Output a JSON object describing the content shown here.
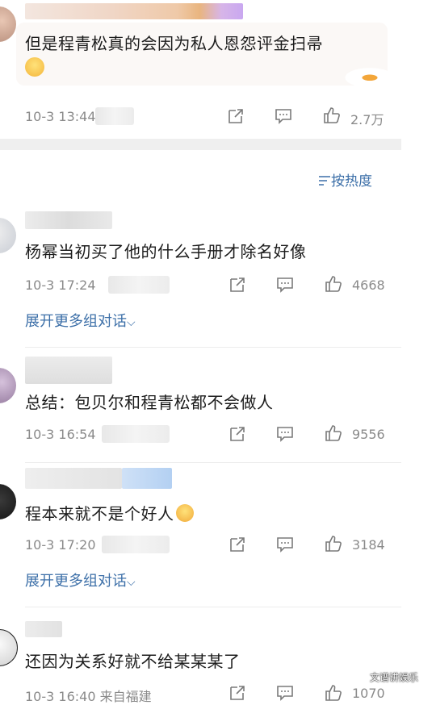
{
  "sort": {
    "label": "按热度",
    "icon": "sort-lines-icon"
  },
  "expand_label": "展开更多组对话",
  "watermark": "文谱讲娱乐",
  "colors": {
    "link": "#3c6fa8",
    "meta": "#8a8a8a",
    "icon": "#7a7a7a"
  },
  "top_comment": {
    "text": "但是程青松真的会因为私人恩怨评金扫帚",
    "time": "10-3 13:44",
    "likes": "2.7万"
  },
  "comments": [
    {
      "text": "杨幂当初买了他的什么手册才除名好像",
      "time": "10-3 17:24",
      "likes": "4668"
    },
    {
      "text": "总结：包贝尔和程青松都不会做人",
      "time": "10-3 16:54",
      "likes": "9556"
    },
    {
      "text": "程本来就不是个好人",
      "time": "10-3 17:20",
      "likes": "3184"
    },
    {
      "text": "还因为关系好就不给某某某了",
      "time": "10-3 16:40 来自福建",
      "likes": "1070"
    }
  ]
}
